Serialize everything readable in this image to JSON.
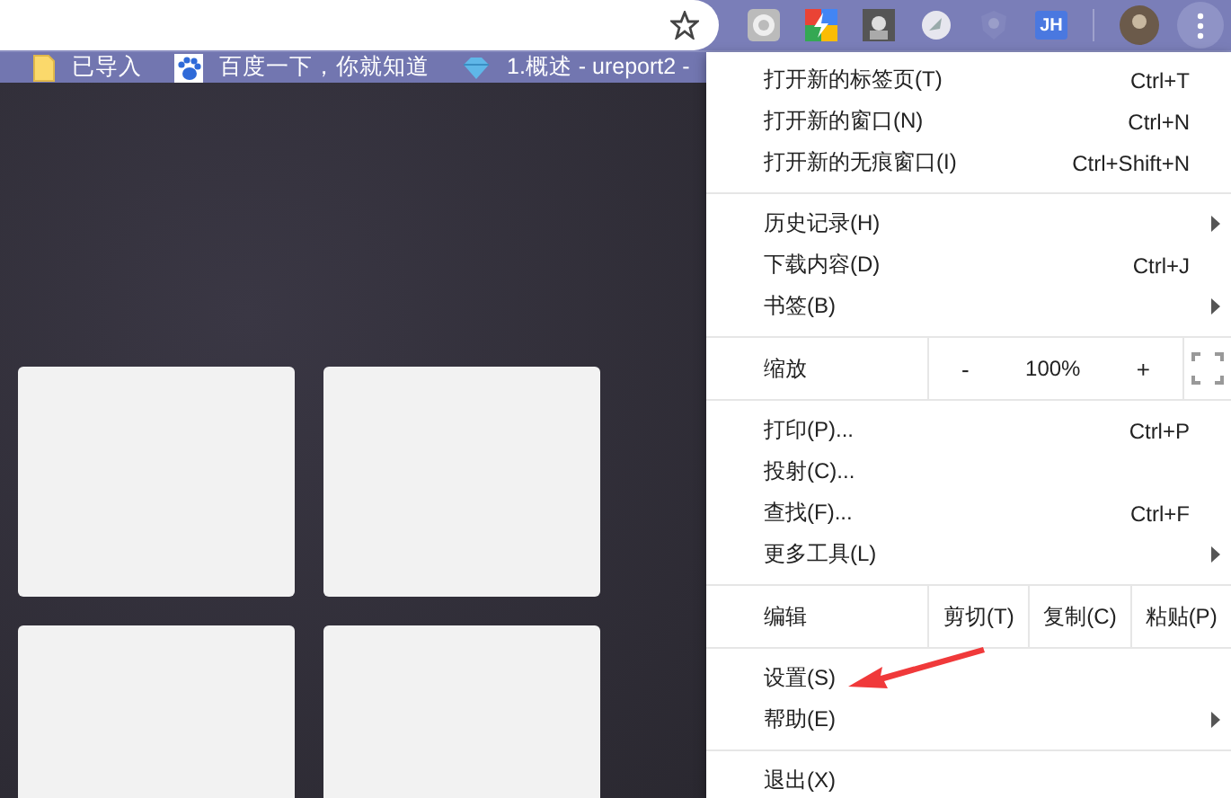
{
  "toolbar": {
    "extension_badge": "JH",
    "menu_open": true
  },
  "bookmarks": [
    {
      "kind": "folder",
      "label": "已导入"
    },
    {
      "kind": "paw",
      "label": "百度一下，你就知道"
    },
    {
      "kind": "gem",
      "label": "1.概述 - ureport2 - "
    }
  ],
  "menu": [
    {
      "kind": "item",
      "label": "打开新的标签页(T)",
      "shortcut": "Ctrl+T",
      "submenu": false
    },
    {
      "kind": "item",
      "label": "打开新的窗口(N)",
      "shortcut": "Ctrl+N",
      "submenu": false
    },
    {
      "kind": "item",
      "label": "打开新的无痕窗口(I)",
      "shortcut": "Ctrl+Shift+N",
      "submenu": false
    },
    {
      "kind": "separator"
    },
    {
      "kind": "item",
      "label": "历史记录(H)",
      "submenu": true
    },
    {
      "kind": "item",
      "label": "下载内容(D)",
      "shortcut": "Ctrl+J",
      "submenu": false
    },
    {
      "kind": "item",
      "label": "书签(B)",
      "submenu": true
    },
    {
      "kind": "separator"
    },
    {
      "kind": "zoom",
      "label": "缩放",
      "minus": "-",
      "value": "100%",
      "plus": "+"
    },
    {
      "kind": "separator"
    },
    {
      "kind": "item",
      "label": "打印(P)...",
      "shortcut": "Ctrl+P",
      "submenu": false
    },
    {
      "kind": "item",
      "label": "投射(C)...",
      "submenu": false
    },
    {
      "kind": "item",
      "label": "查找(F)...",
      "shortcut": "Ctrl+F",
      "submenu": false
    },
    {
      "kind": "item",
      "label": "更多工具(L)",
      "submenu": true
    },
    {
      "kind": "separator"
    },
    {
      "kind": "edit",
      "label": "编辑",
      "buttons": [
        "剪切(T)",
        "复制(C)",
        "粘贴(P)"
      ]
    },
    {
      "kind": "separator"
    },
    {
      "kind": "item",
      "label": "设置(S)",
      "submenu": false
    },
    {
      "kind": "item",
      "label": "帮助(E)",
      "submenu": true
    },
    {
      "kind": "separator"
    },
    {
      "kind": "item",
      "label": "退出(X)",
      "submenu": false
    }
  ]
}
